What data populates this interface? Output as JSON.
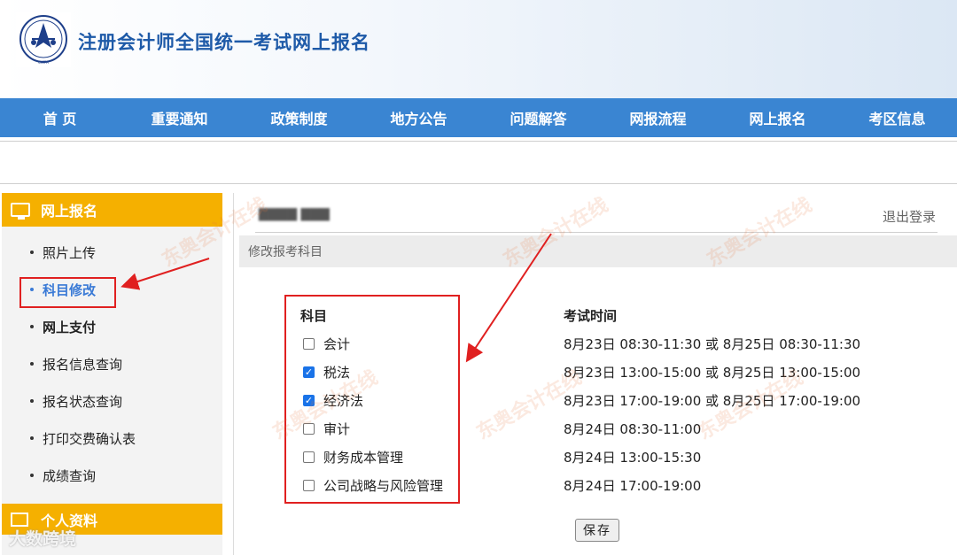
{
  "header": {
    "site_title": "注册会计师全国统一考试网上报名"
  },
  "nav": {
    "items": [
      "首 页",
      "重要通知",
      "政策制度",
      "地方公告",
      "问题解答",
      "网报流程",
      "网上报名",
      "考区信息"
    ]
  },
  "sidebar": {
    "section_title": "网上报名",
    "items": [
      {
        "label": "照片上传"
      },
      {
        "label": "科目修改"
      },
      {
        "label": "网上支付"
      },
      {
        "label": "报名信息查询"
      },
      {
        "label": "报名状态查询"
      },
      {
        "label": "打印交费确认表"
      },
      {
        "label": "成绩查询"
      }
    ],
    "section2_title": "个人资料"
  },
  "main": {
    "user_name": "▇▇▇▇ ▇▇▇",
    "logout_label": "退出登录",
    "section_title": "修改报考科目",
    "subject_header": "科目",
    "time_header": "考试时间",
    "subjects": [
      {
        "name": "会计",
        "checked": false,
        "time": "8月23日  08:30-11:30  或  8月25日  08:30-11:30"
      },
      {
        "name": "税法",
        "checked": true,
        "time": "8月23日  13:00-15:00  或  8月25日  13:00-15:00"
      },
      {
        "name": "经济法",
        "checked": true,
        "time": "8月23日  17:00-19:00  或  8月25日  17:00-19:00"
      },
      {
        "name": "审计",
        "checked": false,
        "time": "8月24日  08:30-11:00"
      },
      {
        "name": "财务成本管理",
        "checked": false,
        "time": "8月24日  13:00-15:30"
      },
      {
        "name": "公司战略与风险管理",
        "checked": false,
        "time": "8月24日  17:00-19:00"
      }
    ],
    "save_label": "保存"
  },
  "watermark": {
    "text": "东奥会计在线",
    "corner": "大数跨境"
  },
  "colors": {
    "nav": "#3a85d2",
    "sidebar_head": "#f5b000",
    "title": "#1e5aa8",
    "highlight": "#e02020",
    "active": "#3a7ad6"
  }
}
